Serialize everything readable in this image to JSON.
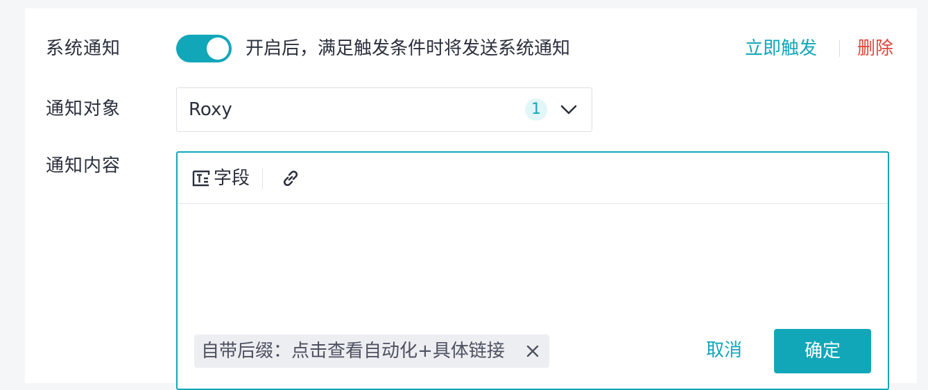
{
  "accent_color": "#11a7b8",
  "danger_color": "#e2453c",
  "system_notice": {
    "label": "系统通知",
    "toggle_on": true,
    "description": "开启后，满足触发条件时将发送系统通知",
    "trigger_now": "立即触发",
    "delete": "删除"
  },
  "recipients": {
    "label": "通知对象",
    "selected_value": "Roxy",
    "selected_count": "1"
  },
  "content": {
    "label": "通知内容",
    "toolbar": {
      "field_label": "字段",
      "field_icon": "text-field-icon",
      "link_icon": "link-icon"
    },
    "suffix_tag": "自带后缀：点击查看自动化+具体链接",
    "cancel_label": "取消",
    "confirm_label": "确定"
  }
}
